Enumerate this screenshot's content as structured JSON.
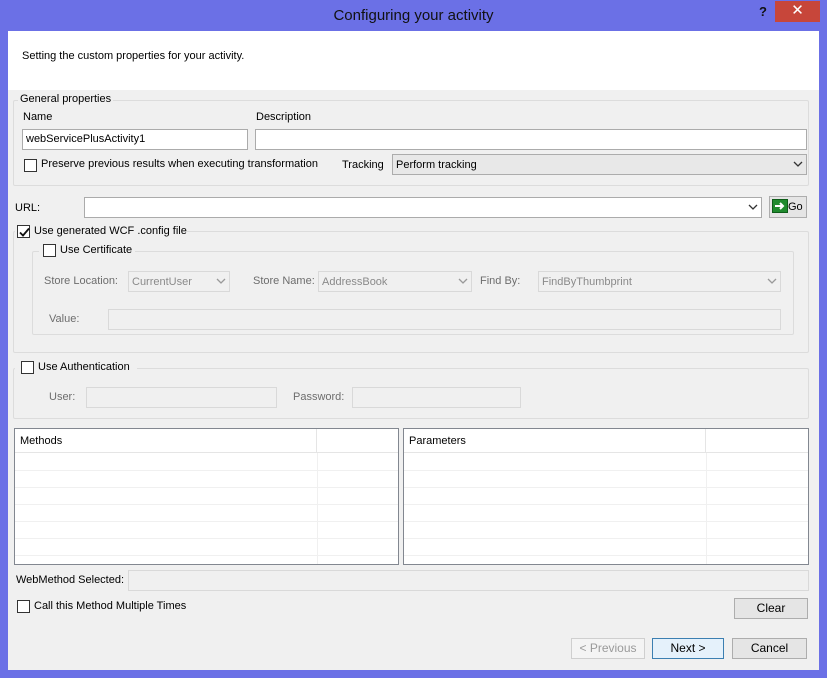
{
  "window": {
    "title": "Configuring your activity",
    "help_label": "?",
    "close_label": "✕"
  },
  "header": {
    "text": "Setting the custom properties for your activity."
  },
  "general": {
    "legend": "General properties",
    "name_label": "Name",
    "name_value": "webServicePlusActivity1",
    "description_label": "Description",
    "description_value": "",
    "preserve_label": "Preserve previous results when executing transformation",
    "preserve_checked": false,
    "tracking_label": "Tracking",
    "tracking_value": "Perform tracking"
  },
  "url": {
    "label": "URL:",
    "value": "",
    "go_label": "Go"
  },
  "wcf": {
    "label": "Use generated WCF .config file",
    "checked": true
  },
  "certificate": {
    "label": "Use Certificate",
    "checked": false,
    "store_location_label": "Store Location:",
    "store_location_value": "CurrentUser",
    "store_name_label": "Store Name:",
    "store_name_value": "AddressBook",
    "find_by_label": "Find By:",
    "find_by_value": "FindByThumbprint",
    "value_label": "Value:",
    "value_value": ""
  },
  "authentication": {
    "label": "Use Authentication",
    "checked": false,
    "user_label": "User:",
    "user_value": "",
    "password_label": "Password:",
    "password_value": ""
  },
  "methods": {
    "header": "Methods",
    "rows": []
  },
  "parameters": {
    "header": "Parameters",
    "rows": []
  },
  "webmethod": {
    "label": "WebMethod Selected:",
    "value": ""
  },
  "multiple": {
    "label": "Call this Method Multiple Times",
    "checked": false
  },
  "buttons": {
    "clear": "Clear",
    "previous": "< Previous",
    "next": "Next >",
    "cancel": "Cancel"
  }
}
